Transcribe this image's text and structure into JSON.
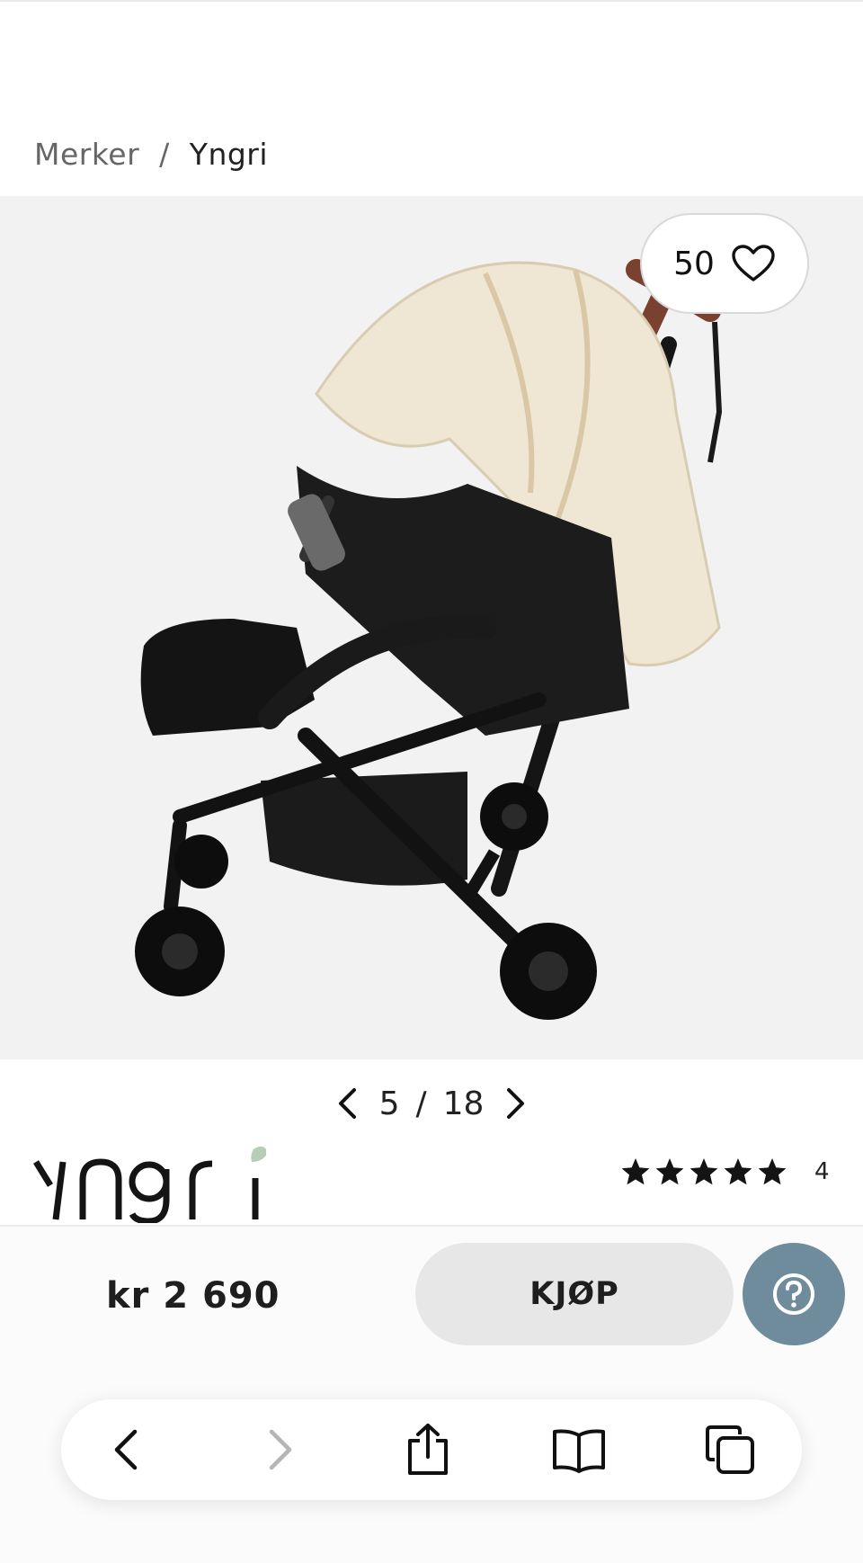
{
  "breadcrumb": {
    "parent": "Merker",
    "separator": "/",
    "current": "Yngri"
  },
  "favorites": {
    "count": "50",
    "icon": "heart-icon"
  },
  "gallery": {
    "current": "5",
    "separator": "/",
    "total": "18",
    "prev_icon": "chevron-left-icon",
    "next_icon": "chevron-right-icon"
  },
  "brand": {
    "logo_text": "Yngri",
    "leaf_color": "#b7cdb8"
  },
  "rating": {
    "stars": 5,
    "review_count": "4"
  },
  "purchase": {
    "price": "kr 2 690",
    "buy_label": "KJØP",
    "help_icon": "question-circle-icon",
    "help_color": "#6e8c9b"
  },
  "browser": {
    "back_icon": "back-arrow-icon",
    "forward_icon": "forward-arrow-icon",
    "share_icon": "share-icon",
    "bookmarks_icon": "book-icon",
    "tabs_icon": "tabs-icon"
  }
}
